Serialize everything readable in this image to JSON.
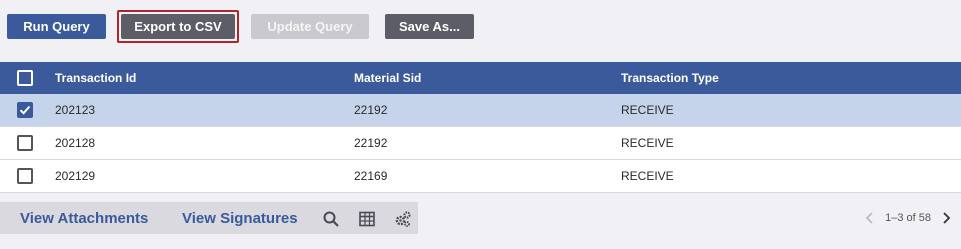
{
  "toolbar": {
    "run_query": "Run Query",
    "export_csv": "Export to CSV",
    "update_query": "Update Query",
    "save_as": "Save As..."
  },
  "grid": {
    "columns": [
      "Transaction Id",
      "Material Sid",
      "Transaction Type"
    ],
    "rows": [
      {
        "transaction_id": "202123",
        "material_sid": "22192",
        "transaction_type": "RECEIVE",
        "checked": true
      },
      {
        "transaction_id": "202128",
        "material_sid": "22192",
        "transaction_type": "RECEIVE",
        "checked": false
      },
      {
        "transaction_id": "202129",
        "material_sid": "22169",
        "transaction_type": "RECEIVE",
        "checked": false
      }
    ]
  },
  "footer": {
    "view_attachments": "View Attachments",
    "view_signatures": "View Signatures",
    "icons": [
      "search-icon",
      "table-icon",
      "settings-gears-icon"
    ]
  },
  "pager": {
    "range_text": "1–3 of 58"
  },
  "colors": {
    "accent": "#3a5a9b",
    "selected_row": "#c5d4ea",
    "focus_border": "#b0242b"
  }
}
